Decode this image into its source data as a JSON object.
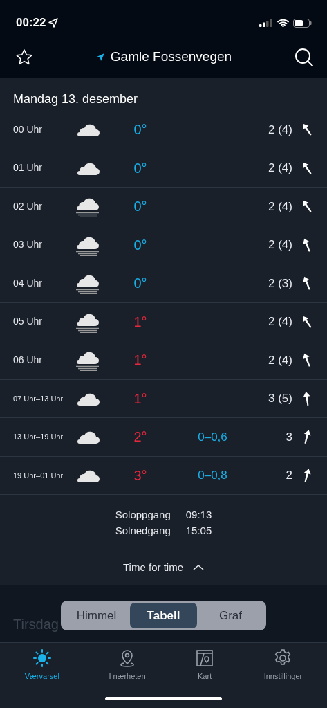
{
  "status_bar": {
    "time": "00:22"
  },
  "header": {
    "title": "Gamle Fossenvegen",
    "favorite": false
  },
  "day": {
    "title": "Mandag 13. desember",
    "rows": [
      {
        "kind": "hour",
        "time": "00 Uhr",
        "sky": {
          "kind": "cloud"
        },
        "temperature": "0°",
        "color": "#1ab0e8",
        "wind": "2 (4)",
        "wind_arrow": {
          "kind": "nw"
        }
      },
      {
        "kind": "hour",
        "time": "01 Uhr",
        "sky": {
          "kind": "cloud"
        },
        "temperature": "0°",
        "color": "#1ab0e8",
        "wind": "2 (4)",
        "wind_arrow": {
          "kind": "nw"
        }
      },
      {
        "kind": "hour",
        "time": "02 Uhr",
        "sky": {
          "kind": "fog"
        },
        "temperature": "0°",
        "color": "#1ab0e8",
        "wind": "2 (4)",
        "wind_arrow": {
          "kind": "nw"
        }
      },
      {
        "kind": "hour",
        "time": "03 Uhr",
        "sky": {
          "kind": "fog"
        },
        "temperature": "0°",
        "color": "#1ab0e8",
        "wind": "2 (4)",
        "wind_arrow": {
          "kind": "nnw"
        }
      },
      {
        "kind": "hour",
        "time": "04 Uhr",
        "sky": {
          "kind": "fog"
        },
        "temperature": "0°",
        "color": "#1ab0e8",
        "wind": "2 (3)",
        "wind_arrow": {
          "kind": "nnw"
        }
      },
      {
        "kind": "hour",
        "time": "05 Uhr",
        "sky": {
          "kind": "fog"
        },
        "temperature": "1°",
        "color": "#e8283c",
        "wind": "2 (4)",
        "wind_arrow": {
          "kind": "nw"
        }
      },
      {
        "kind": "hour",
        "time": "06 Uhr",
        "sky": {
          "kind": "fog"
        },
        "temperature": "1°",
        "color": "#e8283c",
        "wind": "2 (4)",
        "wind_arrow": {
          "kind": "nnw"
        }
      },
      {
        "kind": "period",
        "time": "07 Uhr–13 Uhr",
        "sky": {
          "kind": "cloud"
        },
        "temperature": "1°",
        "color": "#e8283c",
        "wind": "3 (5)",
        "wind_arrow": {
          "kind": "n"
        }
      },
      {
        "kind": "period",
        "time": "13 Uhr–19 Uhr",
        "sky": {
          "kind": "cloud"
        },
        "temperature": "2°",
        "color": "#e8283c",
        "precipitation": "0–0,6",
        "wind": "3",
        "wind_arrow": {
          "kind": "nne"
        }
      },
      {
        "kind": "period",
        "time": "19 Uhr–01 Uhr",
        "sky": {
          "kind": "cloud"
        },
        "temperature": "3°",
        "color": "#e8283c",
        "precipitation": "0–0,8",
        "wind": "2",
        "wind_arrow": {
          "kind": "nne"
        }
      }
    ],
    "sun": [
      {
        "label": "Soloppgang",
        "time": "09:13"
      },
      {
        "label": "Solnedgang",
        "time": "15:05"
      }
    ],
    "toggle": {
      "label": "Time for time",
      "expanded": true
    }
  },
  "next_day": {
    "title": "Tirsdag"
  },
  "view_switch": [
    {
      "label": "Himmel",
      "selected": false
    },
    {
      "label": "Tabell",
      "selected": true
    },
    {
      "label": "Graf",
      "selected": false
    }
  ],
  "tab_bar": [
    {
      "label": "Værvarsel",
      "kind": "sun",
      "selected": true
    },
    {
      "label": "I nærheten",
      "kind": "pin",
      "selected": false
    },
    {
      "label": "Kart",
      "kind": "map",
      "selected": false
    },
    {
      "label": "Innstillinger",
      "kind": "gear",
      "selected": false
    }
  ]
}
